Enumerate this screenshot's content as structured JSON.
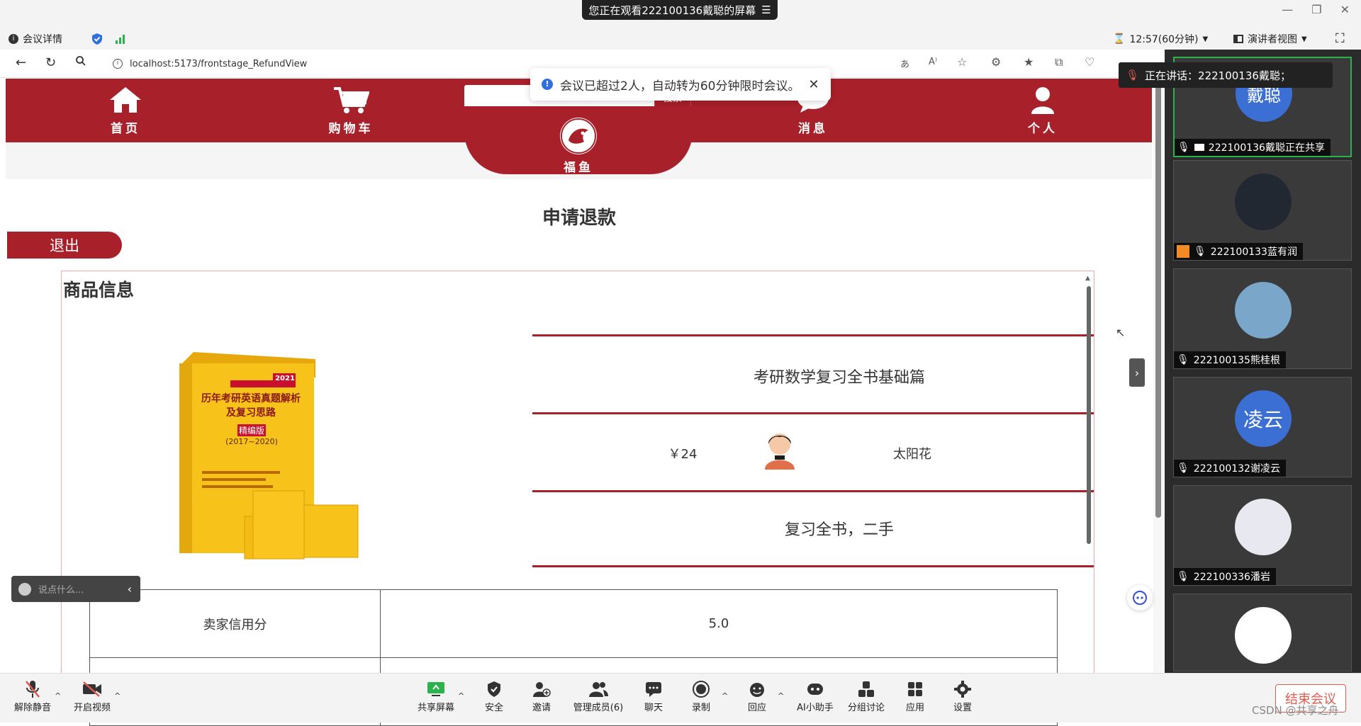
{
  "meeting": {
    "watching_banner": "您正在观看222100136戴聪的屏幕",
    "info_label": "会议详情",
    "timer": "12:57(60分钟)",
    "view_label": "演讲者视图",
    "notice": "会议已超过2人，自动转为60分钟限时会议。",
    "speaking": "正在讲话：222100136戴聪；"
  },
  "browser": {
    "url": "localhost:5173/frontstage_RefundView"
  },
  "site": {
    "nav": [
      "首页",
      "购物车",
      "消息",
      "个人"
    ],
    "search_btn": "搜索",
    "logo_label": "福鱼"
  },
  "page": {
    "title": "申请退款",
    "exit": "退出",
    "section_title": "商品信息",
    "product_name": "考研数学复习全书基础篇",
    "price": "￥24",
    "seller": "太阳花",
    "description": "复习全书，二手",
    "credit_label": "卖家信用分",
    "credit_value": "5.0",
    "book_cover": {
      "title": "历年考研英语真题解析及复习思路",
      "edition": "精编版",
      "years": "(2017~2020)",
      "badge": "2021"
    }
  },
  "chat": {
    "placeholder": "说点什么..."
  },
  "participants": [
    {
      "name": "222100136戴聪正在共享",
      "avatar_text": "戴聪",
      "avatar_color": "#3b6fd4"
    },
    {
      "name": "222100133蓝有润",
      "avatar_text": "",
      "avatar_color": "#222831"
    },
    {
      "name": "222100135熊桂根",
      "avatar_text": "",
      "avatar_color": "#7aa7c9"
    },
    {
      "name": "222100132谢凌云",
      "avatar_text": "凌云",
      "avatar_color": "#3b6fd4"
    },
    {
      "name": "222100336潘岩",
      "avatar_text": "",
      "avatar_color": "#e8e8f0"
    },
    {
      "name": "",
      "avatar_text": "",
      "avatar_color": "#ffffff"
    }
  ],
  "toolbar": {
    "unmute": "解除静音",
    "video": "开启视频",
    "share": "共享屏幕",
    "security": "安全",
    "invite": "邀请",
    "members": "管理成员(6)",
    "chat": "聊天",
    "record": "录制",
    "reaction": "回应",
    "ai": "AI小助手",
    "breakout": "分组讨论",
    "apps": "应用",
    "settings": "设置",
    "end": "结束会议"
  },
  "watermark": "CSDN @共享之舟",
  "colors": {
    "brand_red": "#a8202a",
    "end_red": "#e05a4f",
    "panel_bg": "#2b2b2b"
  }
}
